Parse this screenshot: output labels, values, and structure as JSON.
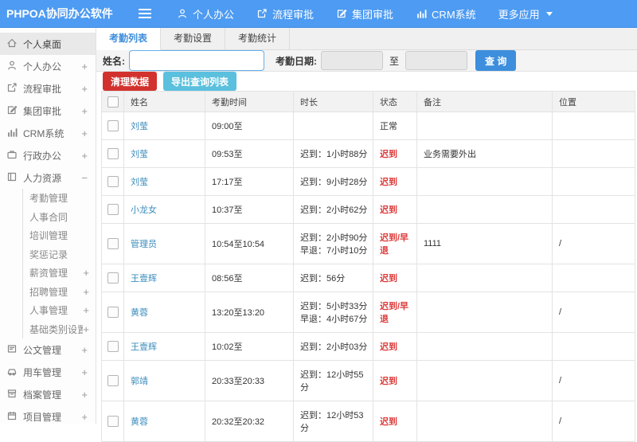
{
  "colors": {
    "navbar": "#4d9bf2",
    "accent": "#3d8edc",
    "link": "#3c8dbc",
    "danger": "#d2322d",
    "info": "#5bc0de",
    "status_red": "#dd3b3b"
  },
  "navbar": {
    "logo": "PHPOA协同办公软件",
    "menu": [
      {
        "key": "personal-office",
        "label": "个人办公",
        "icon": "user"
      },
      {
        "key": "workflow-approval",
        "label": "流程审批",
        "icon": "flow"
      },
      {
        "key": "group-approval",
        "label": "集团审批",
        "icon": "edit"
      },
      {
        "key": "crm",
        "label": "CRM系统",
        "icon": "chart"
      },
      {
        "key": "more-apps",
        "label": "更多应用",
        "icon": "",
        "caret": true
      }
    ]
  },
  "sidebar": {
    "items": [
      {
        "key": "desktop",
        "label": "个人桌面",
        "icon": "home",
        "type": "main",
        "active": true,
        "suffix": ""
      },
      {
        "key": "personal-office",
        "label": "个人办公",
        "icon": "user",
        "type": "main",
        "suffix": "+"
      },
      {
        "key": "workflow-approval",
        "label": "流程审批",
        "icon": "flow",
        "type": "main",
        "suffix": "+"
      },
      {
        "key": "group-approval",
        "label": "集团审批",
        "icon": "edit",
        "type": "main",
        "suffix": "+"
      },
      {
        "key": "crm",
        "label": "CRM系统",
        "icon": "chart",
        "type": "main",
        "suffix": "+"
      },
      {
        "key": "admin-office",
        "label": "行政办公",
        "icon": "briefcase",
        "type": "main",
        "suffix": "+"
      },
      {
        "key": "hr",
        "label": "人力资源",
        "icon": "book",
        "type": "main",
        "suffix": "-"
      },
      {
        "key": "attendance-mgmt",
        "label": "考勤管理",
        "type": "sub",
        "suffix": ""
      },
      {
        "key": "hr-contract",
        "label": "人事合同",
        "type": "sub",
        "suffix": ""
      },
      {
        "key": "training-mgmt",
        "label": "培训管理",
        "type": "sub",
        "suffix": ""
      },
      {
        "key": "reward-record",
        "label": "奖惩记录",
        "type": "sub",
        "suffix": ""
      },
      {
        "key": "salary-mgmt",
        "label": "薪资管理",
        "type": "sub",
        "suffix": "+"
      },
      {
        "key": "recruit-mgmt",
        "label": "招聘管理",
        "type": "sub",
        "suffix": "+"
      },
      {
        "key": "personnel-mgmt",
        "label": "人事管理",
        "type": "sub",
        "suffix": "+"
      },
      {
        "key": "base-category",
        "label": "基础类别设置",
        "type": "sub",
        "suffix": "+"
      },
      {
        "key": "document-mgmt",
        "label": "公文管理",
        "icon": "doc",
        "type": "main",
        "suffix": "+"
      },
      {
        "key": "vehicle-mgmt",
        "label": "用车管理",
        "icon": "car",
        "type": "main",
        "suffix": "+"
      },
      {
        "key": "archive-mgmt",
        "label": "档案管理",
        "icon": "archive",
        "type": "main",
        "suffix": "+"
      },
      {
        "key": "project-mgmt",
        "label": "项目管理",
        "icon": "calendar",
        "type": "main",
        "suffix": "+"
      }
    ]
  },
  "tabs": [
    {
      "key": "attendance-list",
      "label": "考勤列表",
      "active": true
    },
    {
      "key": "attendance-settings",
      "label": "考勤设置",
      "active": false
    },
    {
      "key": "attendance-stats",
      "label": "考勤统计",
      "active": false
    }
  ],
  "search": {
    "name_label": "姓名:",
    "name_value": "",
    "date_label": "考勤日期:",
    "date_from": "",
    "to_label": "至",
    "date_to": "",
    "query_button": "查 询"
  },
  "actions": {
    "clean_button": "清理数据",
    "export_button": "导出查询列表"
  },
  "table": {
    "headers": [
      "姓名",
      "考勤时间",
      "时长",
      "状态",
      "备注",
      "位置"
    ],
    "rows": [
      {
        "name": "刘莹",
        "time": "09:00至",
        "duration": "",
        "status": "正常",
        "remark": "",
        "location": ""
      },
      {
        "name": "刘莹",
        "time": "09:53至",
        "duration": "迟到：1小时88分",
        "status": "迟到",
        "remark": "业务需要外出",
        "location": ""
      },
      {
        "name": "刘莹",
        "time": "17:17至",
        "duration": "迟到：9小时28分",
        "status": "迟到",
        "remark": "",
        "location": ""
      },
      {
        "name": "小龙女",
        "time": "10:37至",
        "duration": "迟到：2小时62分",
        "status": "迟到",
        "remark": "",
        "location": ""
      },
      {
        "name": "管理员",
        "time": "10:54至10:54",
        "duration": "迟到：2小时90分\n早退：7小时10分",
        "status": "迟到/早退",
        "remark": "1111",
        "location": "/"
      },
      {
        "name": "王壹辉",
        "time": "08:56至",
        "duration": "迟到：56分",
        "status": "迟到",
        "remark": "",
        "location": ""
      },
      {
        "name": "黄蓉",
        "time": "13:20至13:20",
        "duration": "迟到：5小时33分\n早退：4小时67分",
        "status": "迟到/早退",
        "remark": "",
        "location": "/"
      },
      {
        "name": "王壹辉",
        "time": "10:02至",
        "duration": "迟到：2小时03分",
        "status": "迟到",
        "remark": "",
        "location": ""
      },
      {
        "name": "郭靖",
        "time": "20:33至20:33",
        "duration": "迟到：12小时55分",
        "status": "迟到",
        "remark": "",
        "location": "/"
      },
      {
        "name": "黄蓉",
        "time": "20:32至20:32",
        "duration": "迟到：12小时53分",
        "status": "迟到",
        "remark": "",
        "location": "/"
      }
    ],
    "status_normal_text": "正常"
  }
}
